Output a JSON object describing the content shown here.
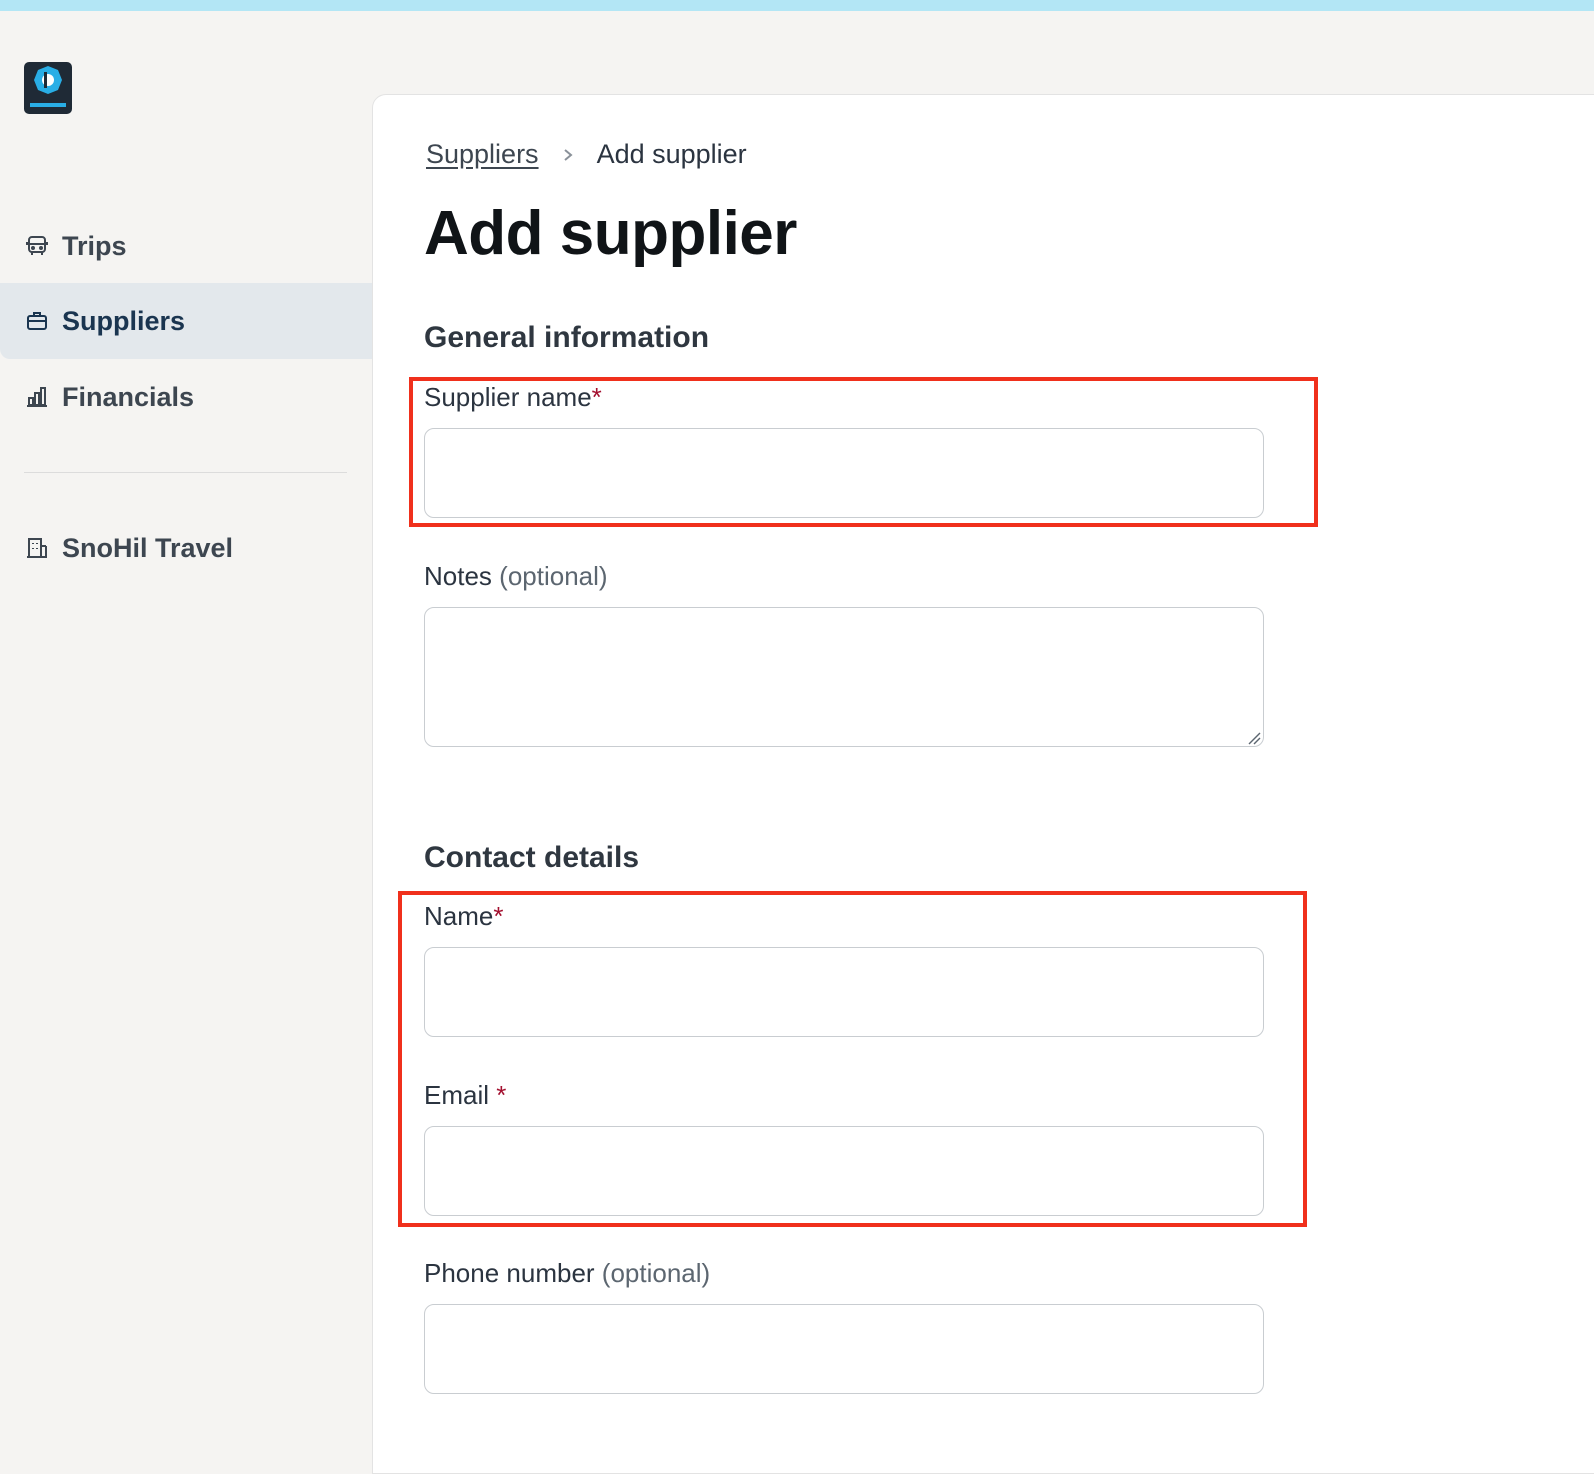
{
  "sidebar": {
    "logo_icon": "app-logo",
    "items": [
      {
        "label": "Trips",
        "icon": "bus-icon"
      },
      {
        "label": "Suppliers",
        "icon": "briefcase-icon",
        "active": true
      },
      {
        "label": "Financials",
        "icon": "bar-chart-icon"
      }
    ],
    "org": {
      "label": "SnoHil Travel",
      "icon": "building-icon"
    }
  },
  "breadcrumb": {
    "parent": "Suppliers",
    "current": "Add supplier"
  },
  "page": {
    "title": "Add supplier"
  },
  "general": {
    "title": "General information",
    "supplier_name_label": "Supplier name",
    "supplier_name_value": "",
    "notes_label": "Notes",
    "notes_optional": "(optional)",
    "notes_value": ""
  },
  "contact": {
    "title": "Contact details",
    "name_label": "Name",
    "name_value": "",
    "email_label": "Email ",
    "email_value": "",
    "phone_label": "Phone number",
    "phone_optional": "(optional)",
    "phone_value": ""
  },
  "required_marker": "*",
  "colors": {
    "accent_strip": "#b3e6f5",
    "required": "#a3102f",
    "highlight": "#f0301c",
    "active_nav_bg": "#e3e8ec"
  }
}
